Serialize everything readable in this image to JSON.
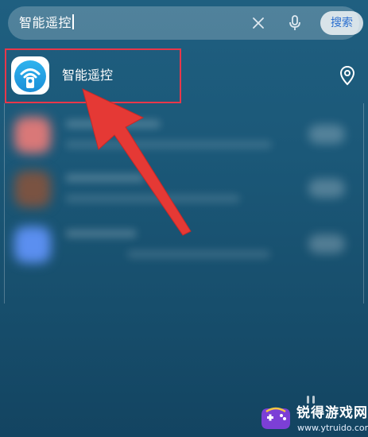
{
  "search": {
    "query": "智能遥控",
    "submit_label": "搜索",
    "icons": [
      "close-icon",
      "microphone-icon"
    ]
  },
  "result": {
    "app_name": "智能遥控",
    "icon": "remote-wifi-app-icon",
    "action_icon": "location-pin-icon"
  },
  "blurred_results": [
    {
      "icon_color": "#d97878"
    },
    {
      "icon_color": "#7a5342"
    },
    {
      "icon_color": "#5b8ff0"
    }
  ],
  "annotation": {
    "highlight_color": "#e8374a",
    "arrow_color": "#e53935"
  },
  "watermark": {
    "name": "锐得游戏网",
    "url": "www.ytruido.com"
  }
}
